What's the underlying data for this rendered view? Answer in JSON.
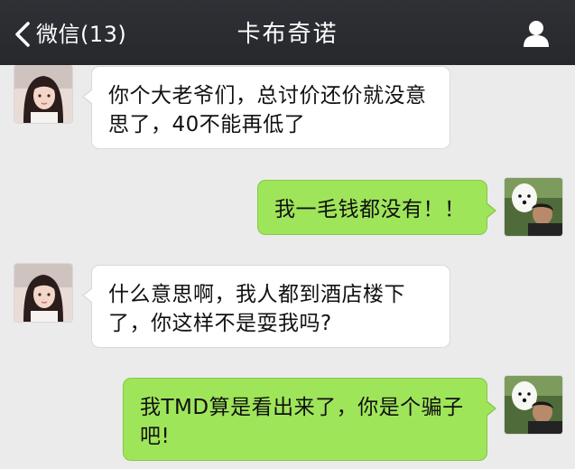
{
  "header": {
    "back_label": "微信(13)",
    "title": "卡布奇诺",
    "back_icon": "chevron-left-icon",
    "profile_icon": "person-icon"
  },
  "messages": [
    {
      "sender": "contact",
      "text": "你个大老爷们，总讨价还价就没意思了，40不能再低了"
    },
    {
      "sender": "self",
      "text": "我一毛钱都没有！！"
    },
    {
      "sender": "contact",
      "text": "什么意思啊，我人都到酒店楼下了，你这样不是耍我吗?"
    },
    {
      "sender": "self",
      "text": "我TMD算是看出来了，你是个骗子吧!"
    }
  ],
  "colors": {
    "header_bg": "#2b2d31",
    "chat_bg": "#ebebeb",
    "incoming_bubble": "#ffffff",
    "outgoing_bubble": "#9fe55a"
  }
}
